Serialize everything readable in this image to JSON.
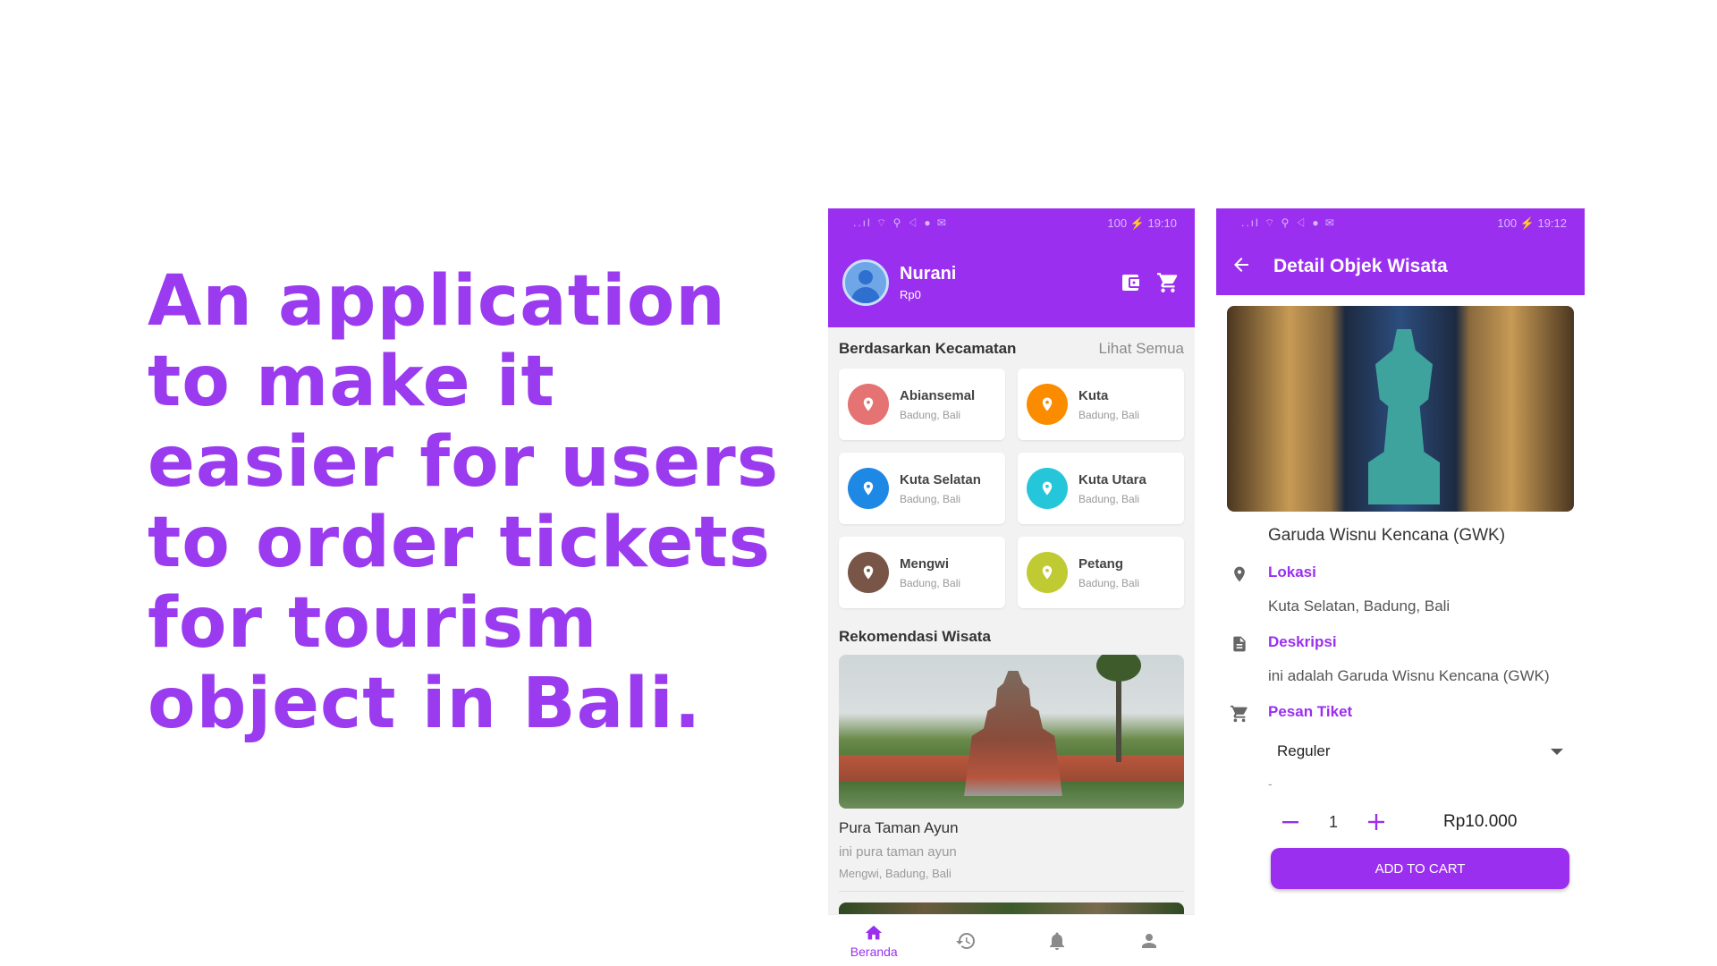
{
  "headline": "An application to make it easier for users to order tickets for tourism object in Bali.",
  "colors": {
    "primary": "#9b2ff0",
    "headline": "#9a3bef"
  },
  "home": {
    "status": {
      "icons": "..ıl ⌔ ⚲ ◁ ● ✉",
      "battery_time": "100 ⚡ 19:10"
    },
    "user": {
      "name": "Nurani",
      "balance": "Rp0"
    },
    "header_icons": [
      "wallet-icon",
      "cart-icon"
    ],
    "districts_title": "Berdasarkan Kecamatan",
    "see_all": "Lihat Semua",
    "districts": [
      {
        "name": "Abiansemal",
        "sub": "Badung, Bali",
        "color": "#e57373"
      },
      {
        "name": "Kuta",
        "sub": "Badung, Bali",
        "color": "#fb8c00"
      },
      {
        "name": "Kuta Selatan",
        "sub": "Badung, Bali",
        "color": "#1e88e5"
      },
      {
        "name": "Kuta Utara",
        "sub": "Badung, Bali",
        "color": "#26c6da"
      },
      {
        "name": "Mengwi",
        "sub": "Badung, Bali",
        "color": "#795548"
      },
      {
        "name": "Petang",
        "sub": "Badung, Bali",
        "color": "#c0ca33"
      }
    ],
    "recommend_title": "Rekomendasi Wisata",
    "recommendation": {
      "name": "Pura Taman Ayun",
      "desc": "ini pura taman ayun",
      "location": "Mengwi, Badung, Bali"
    },
    "nav": {
      "home_label": "Beranda"
    }
  },
  "detail": {
    "status": {
      "icons": "..ıl ⌔ ⚲ ◁ ● ✉",
      "battery_time": "100 ⚡ 19:12"
    },
    "title": "Detail Objek Wisata",
    "place_name": "Garuda Wisnu Kencana (GWK)",
    "location_label": "Lokasi",
    "location_value": "Kuta Selatan, Badung, Bali",
    "desc_label": "Deskripsi",
    "desc_value": "ini adalah Garuda Wisnu Kencana (GWK)",
    "ticket_label": "Pesan Tiket",
    "ticket_type": "Reguler",
    "dash": "-",
    "quantity": "1",
    "price": "Rp10.000",
    "add_to_cart": "ADD TO CART"
  }
}
